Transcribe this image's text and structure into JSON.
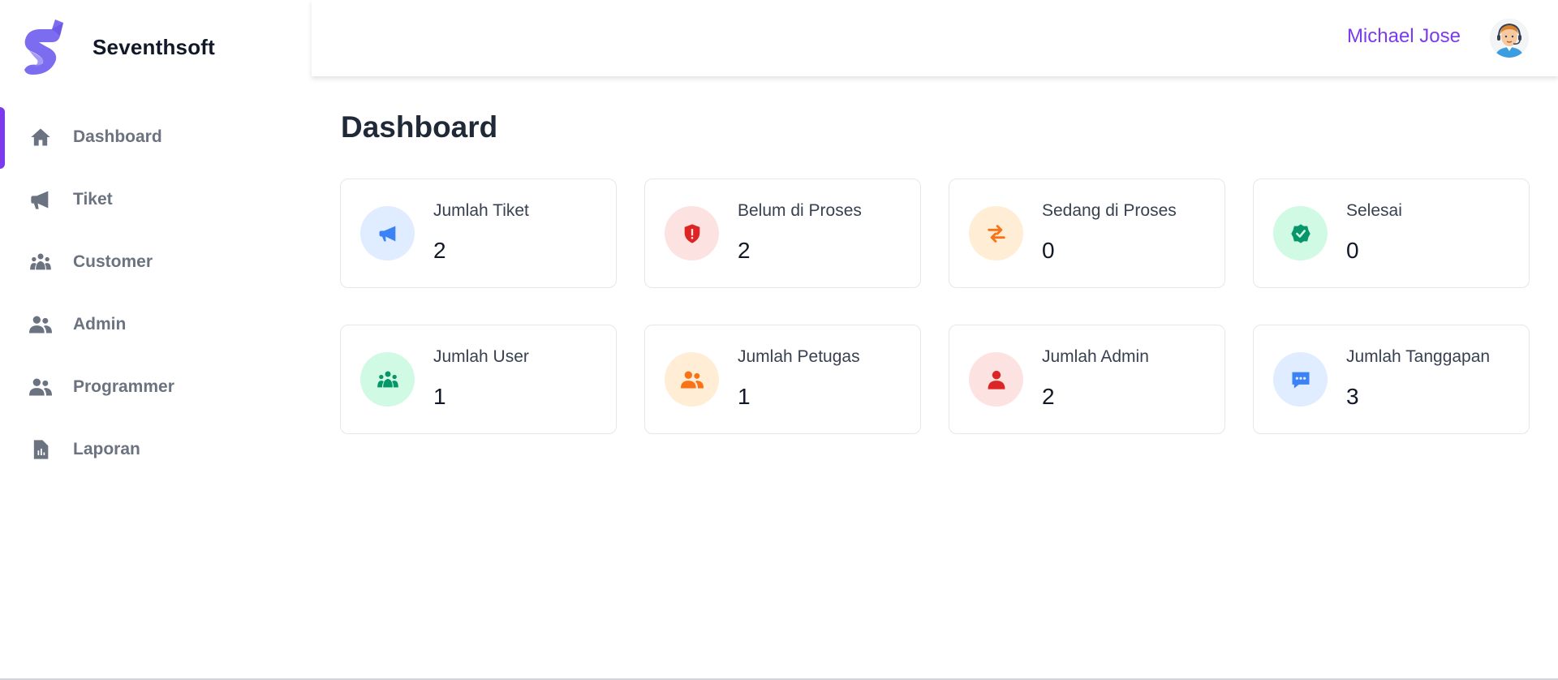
{
  "brand": {
    "name": "Seventhsoft",
    "logo_color": "#7c6cf0"
  },
  "sidebar": {
    "items": [
      {
        "label": "Dashboard",
        "icon": "home-icon",
        "active": true
      },
      {
        "label": "Tiket",
        "icon": "megaphone-icon",
        "active": false
      },
      {
        "label": "Customer",
        "icon": "users-group-icon",
        "active": false
      },
      {
        "label": "Admin",
        "icon": "users-icon",
        "active": false
      },
      {
        "label": "Programmer",
        "icon": "users-icon",
        "active": false
      },
      {
        "label": "Laporan",
        "icon": "report-file-icon",
        "active": false
      }
    ]
  },
  "header": {
    "user_name": "Michael Jose",
    "avatar": "support-agent-avatar"
  },
  "main": {
    "title": "Dashboard",
    "cards": [
      {
        "title": "Jumlah Tiket",
        "value": "2",
        "icon": "megaphone-icon",
        "bg": "#e0ecff",
        "fg": "#3b82f6"
      },
      {
        "title": "Belum di Proses",
        "value": "2",
        "icon": "shield-alert-icon",
        "bg": "#fde2e2",
        "fg": "#dc2626"
      },
      {
        "title": "Sedang di Proses",
        "value": "0",
        "icon": "swap-arrows-icon",
        "bg": "#ffedd5",
        "fg": "#f97316"
      },
      {
        "title": "Selesai",
        "value": "0",
        "icon": "check-badge-icon",
        "bg": "#d1fae5",
        "fg": "#059669"
      },
      {
        "title": "Jumlah User",
        "value": "1",
        "icon": "users-group-icon",
        "bg": "#d1fae5",
        "fg": "#059669"
      },
      {
        "title": "Jumlah Petugas",
        "value": "1",
        "icon": "users-icon",
        "bg": "#ffedd5",
        "fg": "#f97316"
      },
      {
        "title": "Jumlah Admin",
        "value": "2",
        "icon": "user-icon",
        "bg": "#fde2e2",
        "fg": "#dc2626"
      },
      {
        "title": "Jumlah Tanggapan",
        "value": "3",
        "icon": "chat-bubble-icon",
        "bg": "#e0ecff",
        "fg": "#3b82f6"
      }
    ]
  }
}
